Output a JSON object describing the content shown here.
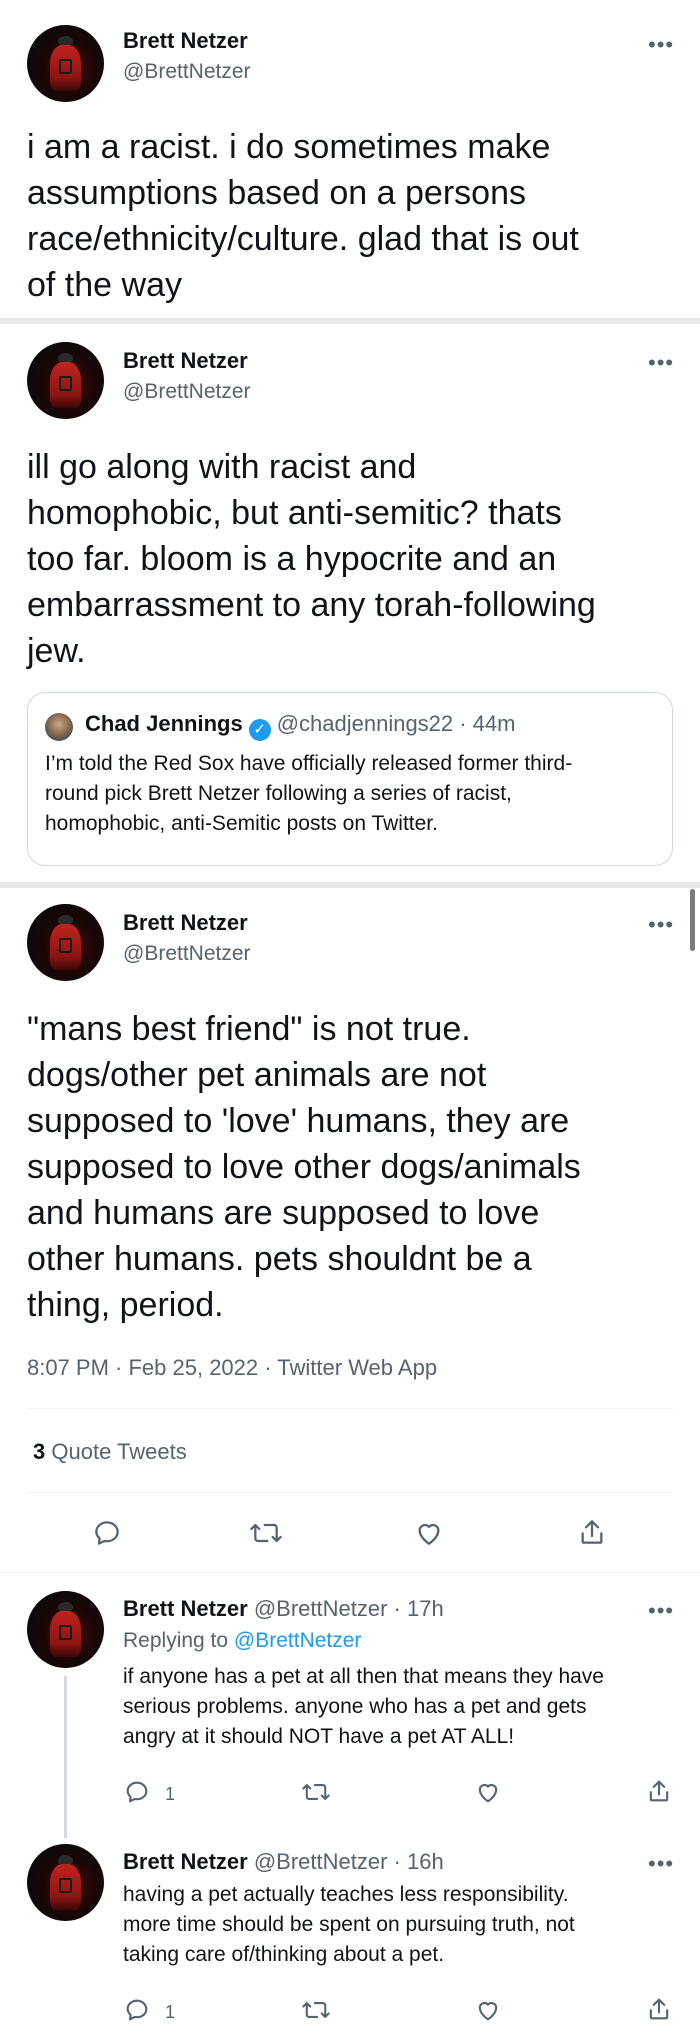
{
  "tweets": [
    {
      "name": "Brett Netzer",
      "handle": "@BrettNetzer",
      "text_lines": [
        "i am a racist. i do sometimes make",
        "assumptions based on a persons",
        "race/ethnicity/culture. glad that is out",
        "of the way"
      ]
    },
    {
      "name": "Brett Netzer",
      "handle": "@BrettNetzer",
      "text_lines": [
        "ill go along with racist and",
        "homophobic, but anti-semitic? thats",
        "too far. bloom is a hypocrite and an",
        "embarrassment to any torah-following",
        "jew."
      ],
      "quoted": {
        "name": "Chad Jennings",
        "handle_time": "@chadjennings22 · 44m",
        "text_lines": [
          "I’m told the Red Sox have officially released former third-",
          "round pick Brett Netzer following a series of racist,",
          "homophobic, anti-Semitic posts on Twitter."
        ]
      }
    },
    {
      "name": "Brett Netzer",
      "handle": "@BrettNetzer",
      "text_lines": [
        "\"mans best friend\" is not true.",
        "dogs/other pet animals are not",
        "supposed to 'love' humans, they are",
        "supposed to love other dogs/animals",
        "and humans are supposed to love",
        "other humans. pets shouldnt be a",
        "thing, period."
      ],
      "timestamp": "8:07 PM · Feb 25, 2022 · Twitter Web App",
      "quote_count": "3",
      "quote_label": "Quote Tweets"
    }
  ],
  "replies": [
    {
      "name": "Brett Netzer",
      "handle_time": "@BrettNetzer · 17h",
      "replying_prefix": "Replying to ",
      "replying_handle": "@BrettNetzer",
      "text_lines": [
        "if anyone has a pet at all then that means they have",
        "serious problems. anyone who has a pet and gets",
        "angry at it should NOT have a pet AT ALL!"
      ],
      "reply_count": "1"
    },
    {
      "name": "Brett Netzer",
      "handle_time": "@BrettNetzer · 16h",
      "text_lines": [
        "having a pet actually teaches less responsibility.",
        "more time should be spent on pursuing truth, not",
        "taking care of/thinking about a pet."
      ],
      "reply_count": "1"
    }
  ],
  "more_glyph": "•••",
  "icons": [
    "reply-icon",
    "retweet-icon",
    "like-icon",
    "share-icon",
    "more-icon",
    "verified-icon"
  ],
  "colors": {
    "link": "#1d9bf0",
    "secondary": "#536471",
    "divider": "#e6e8ea",
    "text": "#0f1419"
  }
}
